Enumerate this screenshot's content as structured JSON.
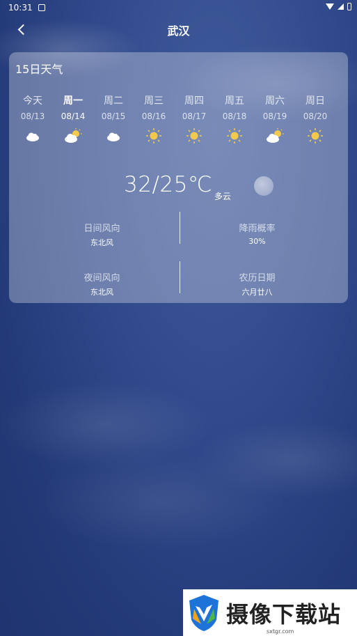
{
  "status_bar": {
    "time": "10:31"
  },
  "header": {
    "city": "武汉"
  },
  "forecast": {
    "title": "15日天气",
    "days": [
      {
        "weekday": "今天",
        "date": "08/13",
        "icon": "cloud-icon"
      },
      {
        "weekday": "周一",
        "date": "08/14",
        "icon": "partly-sunny-icon"
      },
      {
        "weekday": "周二",
        "date": "08/15",
        "icon": "cloud-icon"
      },
      {
        "weekday": "周三",
        "date": "08/16",
        "icon": "sun-icon"
      },
      {
        "weekday": "周四",
        "date": "08/17",
        "icon": "sun-icon"
      },
      {
        "weekday": "周五",
        "date": "08/18",
        "icon": "sun-icon"
      },
      {
        "weekday": "周六",
        "date": "08/19",
        "icon": "partly-sunny-icon"
      },
      {
        "weekday": "周日",
        "date": "08/20",
        "icon": "sun-icon"
      }
    ],
    "selected_index": 1
  },
  "current": {
    "temperature": "32/25℃",
    "condition": "多云"
  },
  "details": {
    "day_wind_label": "日间风向",
    "day_wind_value": "东北风",
    "rain_prob_label": "降雨概率",
    "rain_prob_value": "30%",
    "night_wind_label": "夜间风向",
    "night_wind_value": "东北风",
    "lunar_label": "农历日期",
    "lunar_value": "六月廿八"
  },
  "watermark": {
    "name": "摄像下载站",
    "url": "sxtgr.com"
  },
  "colors": {
    "sun": "#f2c94c",
    "background": "#2b4384"
  }
}
